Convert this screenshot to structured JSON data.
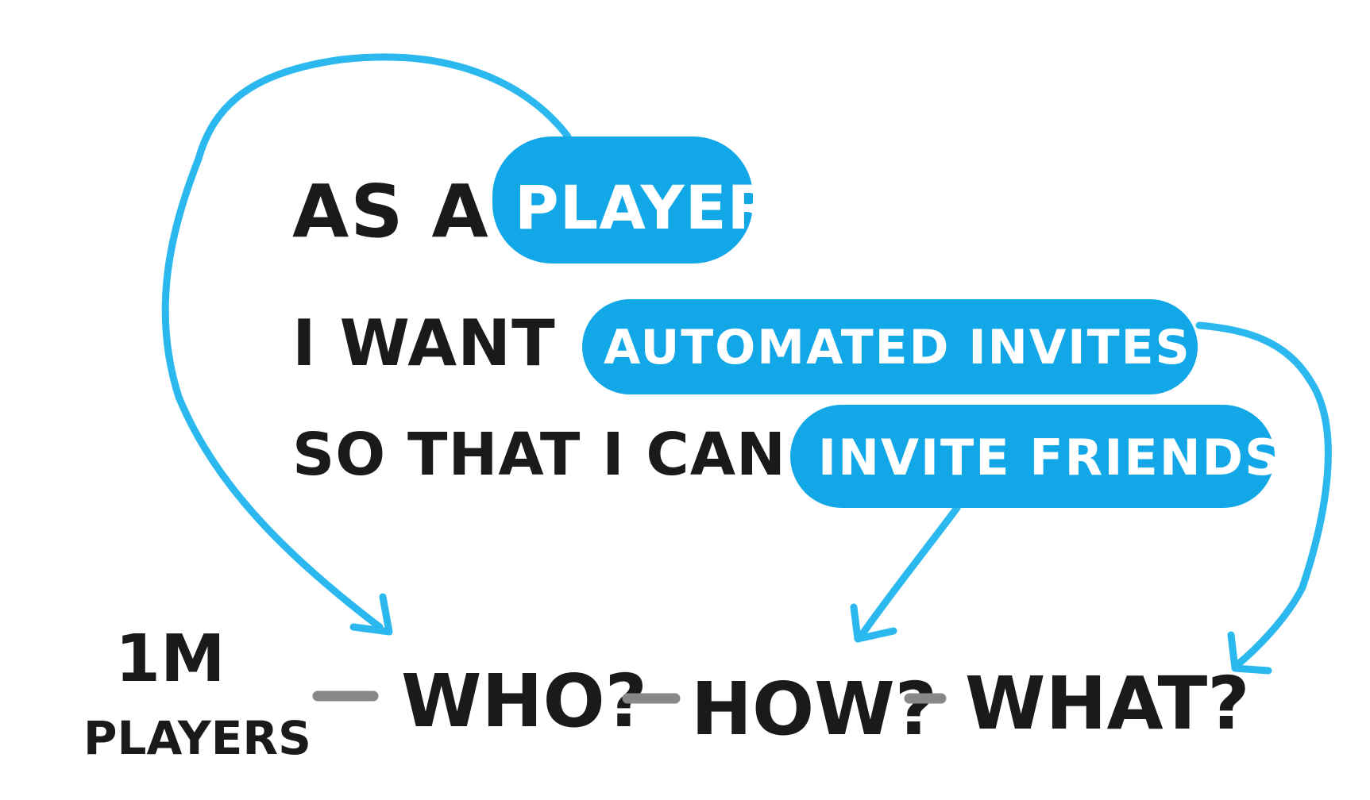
{
  "story": {
    "role_prefix": "As a",
    "role": "player",
    "want_prefix": "I want",
    "want": "automated invites",
    "goal_prefix": "So that I can",
    "goal": "invite friends"
  },
  "chain": {
    "metric_top": "1M",
    "metric_bottom": "players",
    "who": "Who?",
    "how": "How?",
    "what": "What?"
  },
  "colors": {
    "pill": "#12a8e8",
    "arrow": "#2ab8ee",
    "ink": "#1a1a1a",
    "dash": "#888888"
  }
}
